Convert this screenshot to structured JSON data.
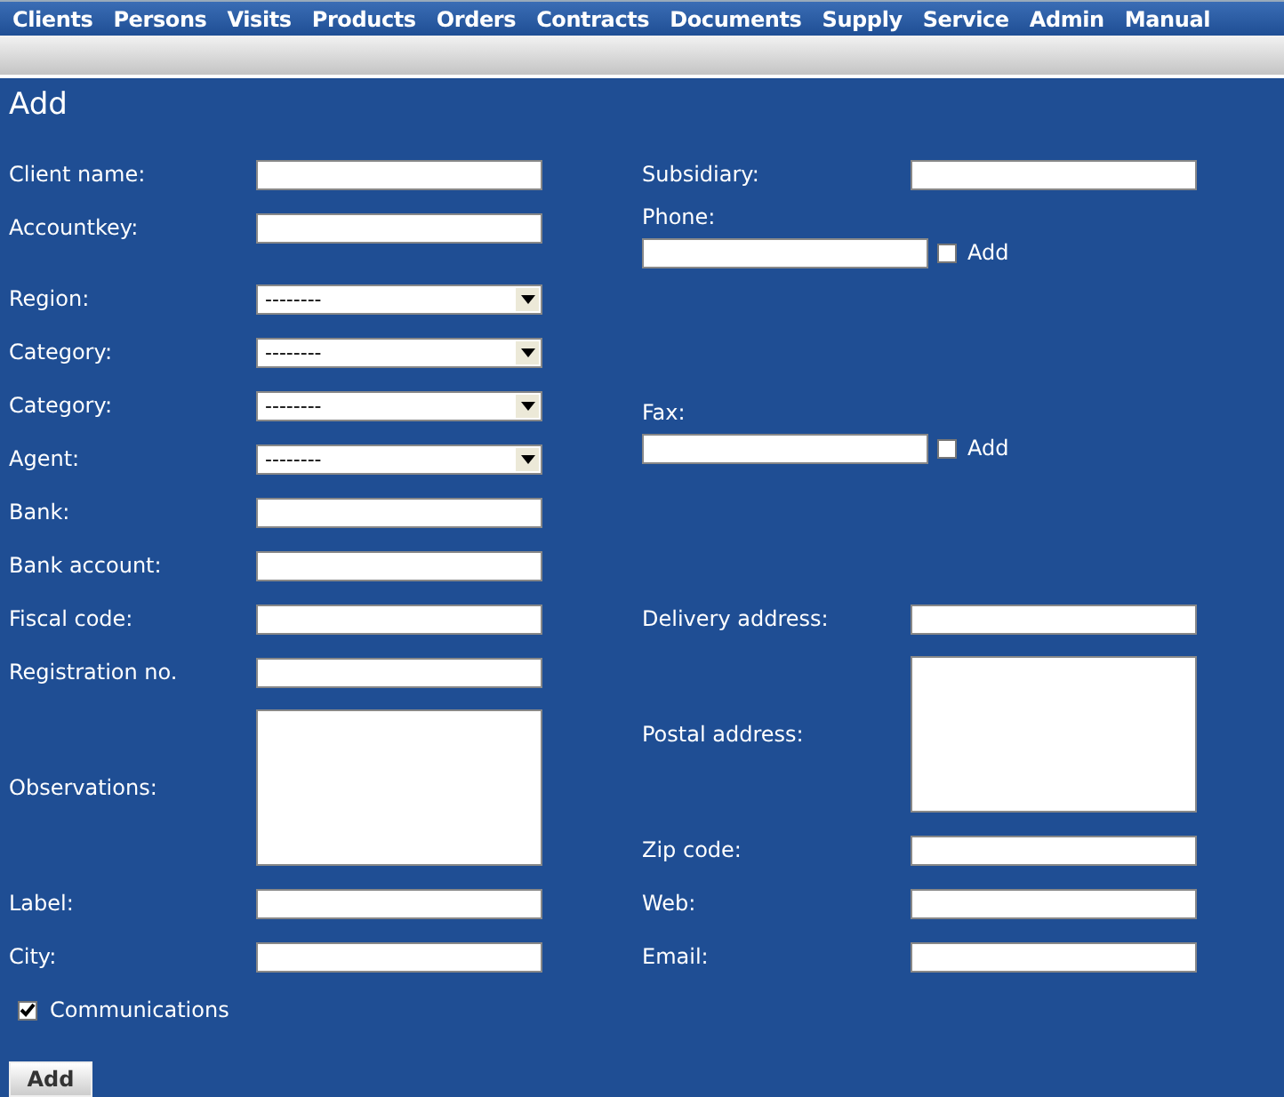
{
  "menu": [
    {
      "label": "Clients"
    },
    {
      "label": "Persons"
    },
    {
      "label": "Visits"
    },
    {
      "label": "Products"
    },
    {
      "label": "Orders"
    },
    {
      "label": "Contracts"
    },
    {
      "label": "Documents"
    },
    {
      "label": "Supply"
    },
    {
      "label": "Service"
    },
    {
      "label": "Admin"
    },
    {
      "label": "Manual"
    }
  ],
  "title": "Add",
  "left_fields": [
    {
      "kind": "text",
      "label": "Client name:"
    },
    {
      "kind": "text",
      "label": "Accountkey:"
    },
    {
      "kind": "select",
      "label": "Region:",
      "value": "--------"
    },
    {
      "kind": "select",
      "label": "Category:",
      "value": "--------"
    },
    {
      "kind": "select",
      "label": "Category:",
      "value": "--------"
    },
    {
      "kind": "select",
      "label": "Agent:",
      "value": "--------"
    },
    {
      "kind": "text",
      "label": "Bank:"
    },
    {
      "kind": "text",
      "label": "Bank account:"
    },
    {
      "kind": "text",
      "label": "Fiscal code:"
    },
    {
      "kind": "text",
      "label": "Registration no."
    },
    {
      "kind": "textarea",
      "label": "Observations:"
    },
    {
      "kind": "text",
      "label": "Label:"
    },
    {
      "kind": "text",
      "label": "City:"
    },
    {
      "kind": "checkbox",
      "label": "Communications",
      "checked": true
    }
  ],
  "right_fields": [
    {
      "kind": "text",
      "label": "Subsidiary:"
    },
    {
      "kind": "stacked",
      "label": "Phone:",
      "check_label": "Add",
      "checked": false
    },
    {
      "kind": "stacked",
      "label": "Fax:",
      "check_label": "Add",
      "checked": false
    },
    {
      "kind": "text",
      "label": "Delivery address:"
    },
    {
      "kind": "textarea",
      "label": "Postal address:"
    },
    {
      "kind": "text",
      "label": "Zip code:"
    },
    {
      "kind": "text",
      "label": "Web:"
    },
    {
      "kind": "text",
      "label": "Email:"
    }
  ],
  "submit": "Add"
}
